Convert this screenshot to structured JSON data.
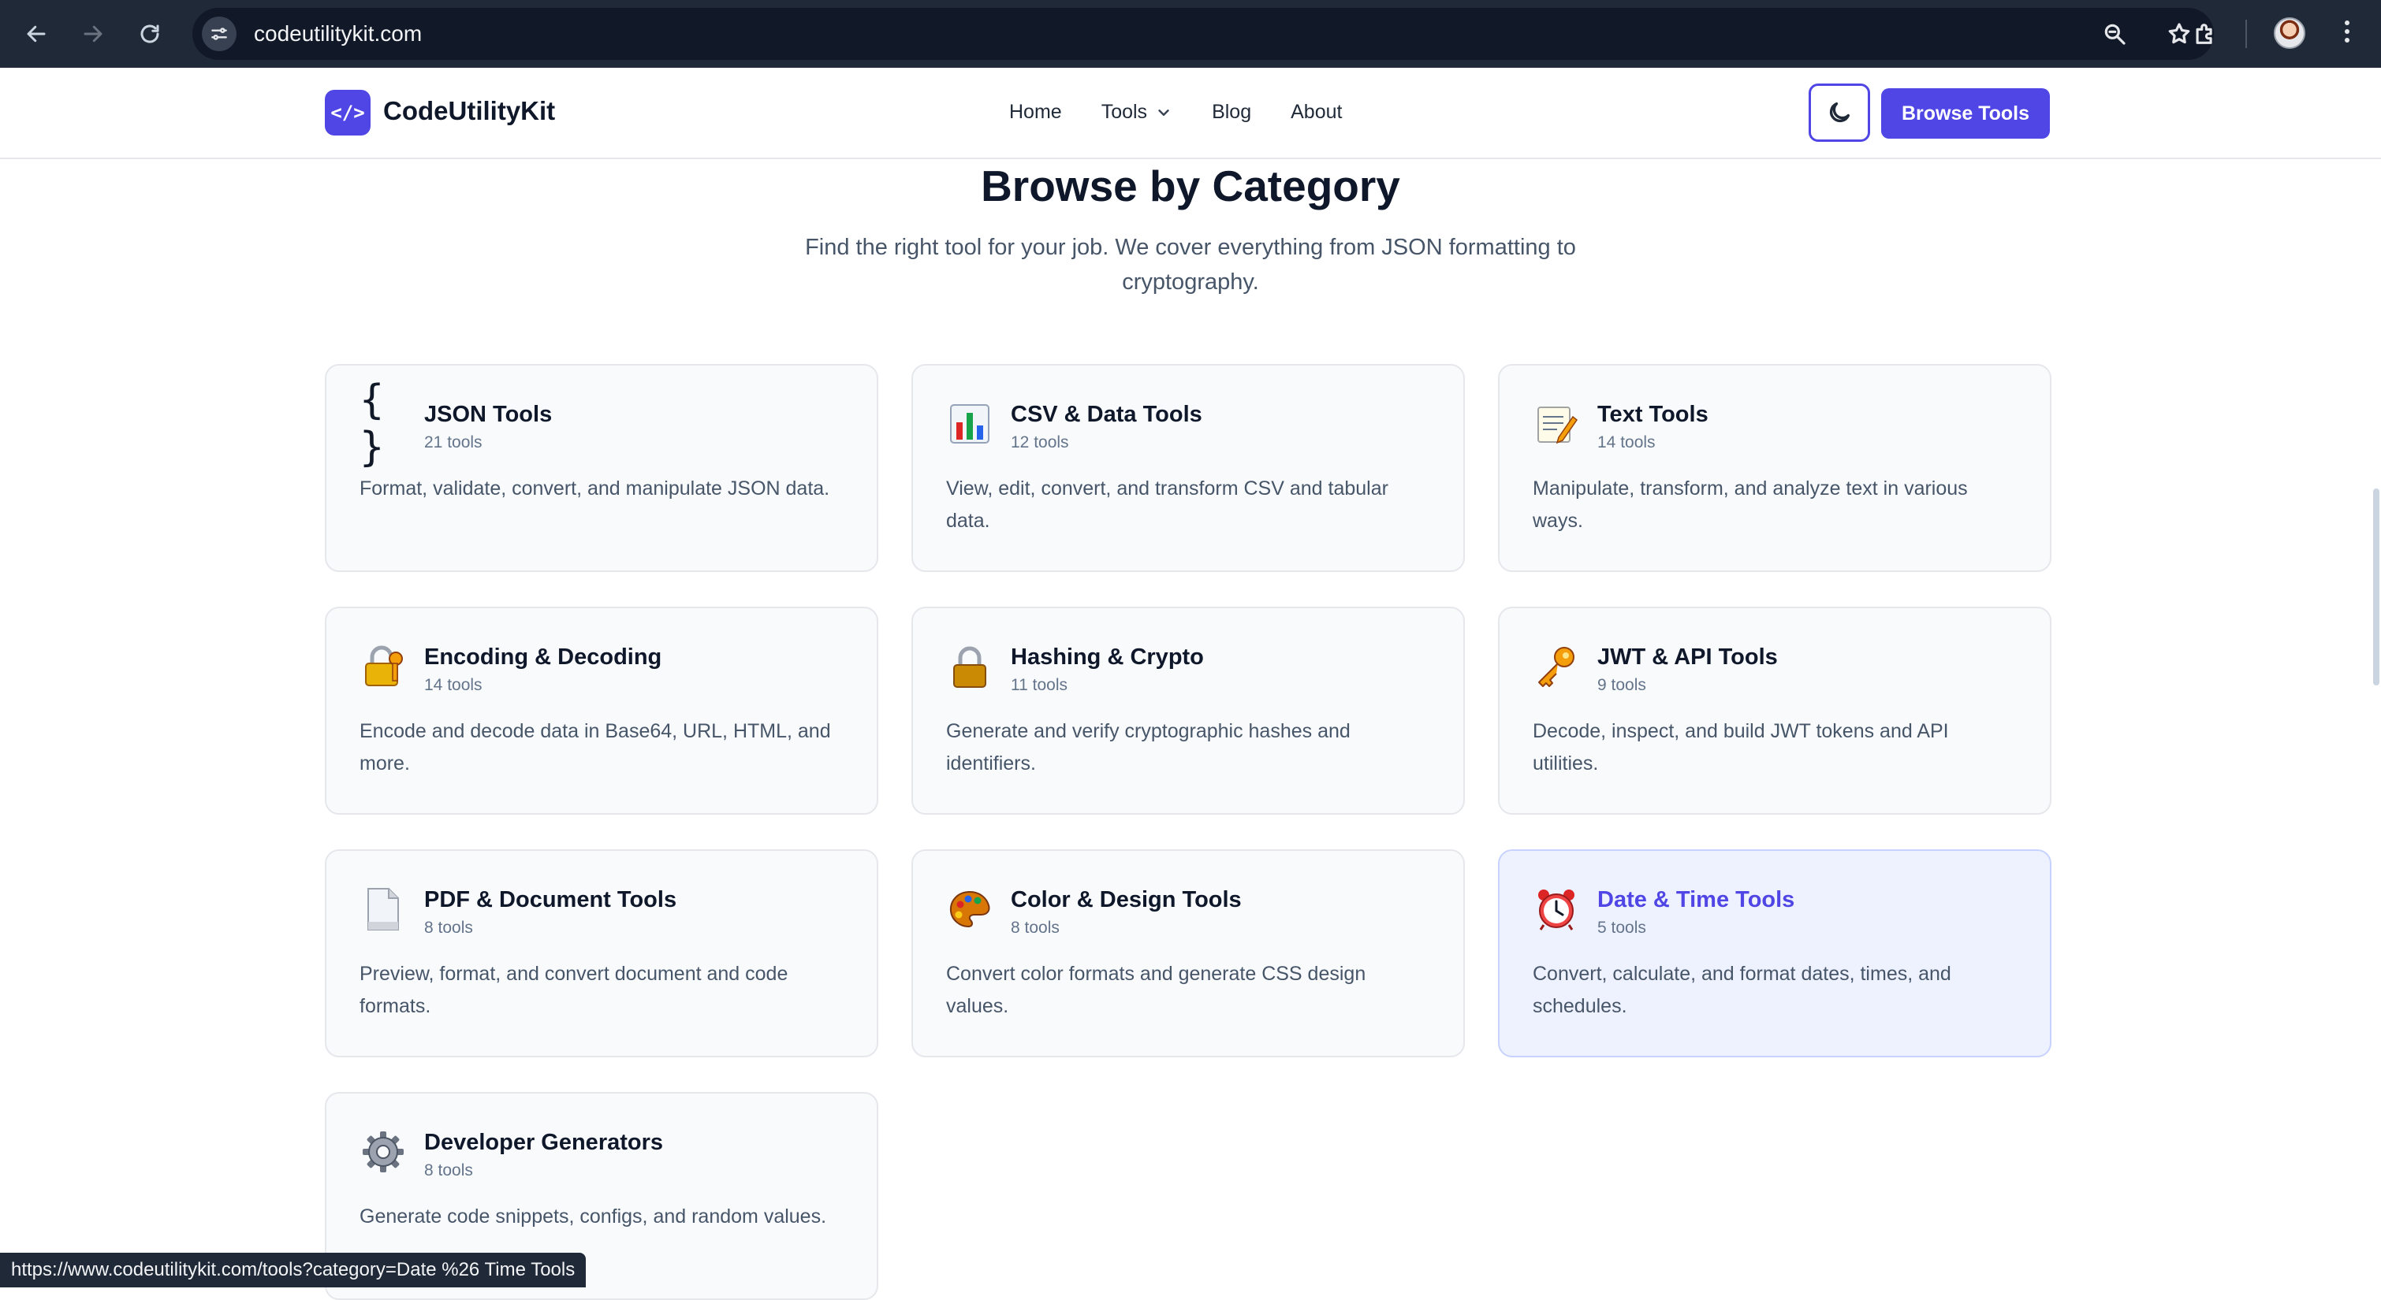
{
  "browser": {
    "url": "codeutilitykit.com",
    "status_url": "https://www.codeutilitykit.com/tools?category=Date %26 Time Tools"
  },
  "header": {
    "logo_mark": "</>",
    "brand": "CodeUtilityKit",
    "nav": [
      "Home",
      "Tools",
      "Blog",
      "About"
    ],
    "browse_label": "Browse Tools"
  },
  "section": {
    "title": "Browse by Category",
    "subtitle": "Find the right tool for your job. We cover everything from JSON formatting to cryptography."
  },
  "categories": [
    {
      "name": "JSON Tools",
      "count": "21 tools",
      "desc": "Format, validate, convert, and manipulate JSON data.",
      "icon": "braces-icon"
    },
    {
      "name": "CSV & Data Tools",
      "count": "12 tools",
      "desc": "View, edit, convert, and transform CSV and tabular data.",
      "icon": "bar-chart-icon"
    },
    {
      "name": "Text Tools",
      "count": "14 tools",
      "desc": "Manipulate, transform, and analyze text in various ways.",
      "icon": "memo-icon"
    },
    {
      "name": "Encoding & Decoding",
      "count": "14 tools",
      "desc": "Encode and decode data in Base64, URL, HTML, and more.",
      "icon": "lock-key-icon"
    },
    {
      "name": "Hashing & Crypto",
      "count": "11 tools",
      "desc": "Generate and verify cryptographic hashes and identifiers.",
      "icon": "padlock-icon"
    },
    {
      "name": "JWT & API Tools",
      "count": "9 tools",
      "desc": "Decode, inspect, and build JWT tokens and API utilities.",
      "icon": "key-icon"
    },
    {
      "name": "PDF & Document Tools",
      "count": "8 tools",
      "desc": "Preview, format, and convert document and code formats.",
      "icon": "document-icon"
    },
    {
      "name": "Color & Design Tools",
      "count": "8 tools",
      "desc": "Convert color formats and generate CSS design values.",
      "icon": "palette-icon"
    },
    {
      "name": "Date & Time Tools",
      "count": "5 tools",
      "desc": "Convert, calculate, and format dates, times, and schedules.",
      "icon": "alarm-clock-icon"
    },
    {
      "name": "Developer Generators",
      "count": "8 tools",
      "desc": "Generate code snippets, configs, and random values.",
      "icon": "gear-icon"
    }
  ],
  "colors": {
    "accent": "#4f46e5",
    "active_card_bg": "#eef2ff"
  }
}
